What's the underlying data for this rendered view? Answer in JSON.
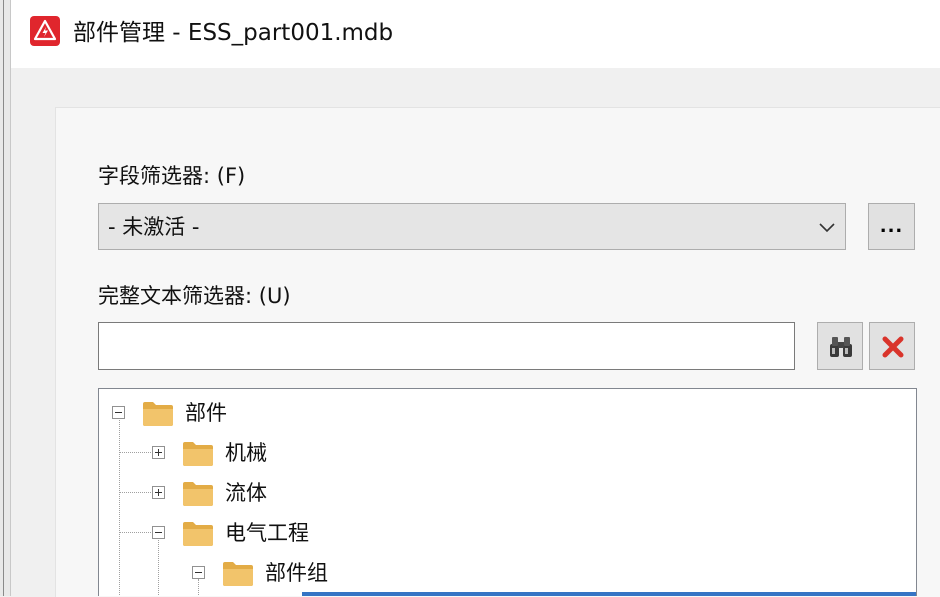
{
  "window": {
    "title": "部件管理 - ESS_part001.mdb"
  },
  "field_filter": {
    "label": "字段筛选器: (F)",
    "value": "- 未激活 -",
    "more_button_label": "..."
  },
  "fulltext_filter": {
    "label": "完整文本筛选器: (U)",
    "value": ""
  },
  "tree": {
    "nodes": [
      {
        "label": "部件",
        "state": "expanded"
      },
      {
        "label": "机械",
        "state": "collapsed"
      },
      {
        "label": "流体",
        "state": "collapsed"
      },
      {
        "label": "电气工程",
        "state": "expanded"
      },
      {
        "label": "部件组",
        "state": "expanded"
      }
    ]
  },
  "colors": {
    "app_icon": "#e0262d",
    "folder": "#f2c46b",
    "folder_tab": "#e3ac46",
    "clear_icon": "#d9342b",
    "selection": "#3574c4"
  }
}
